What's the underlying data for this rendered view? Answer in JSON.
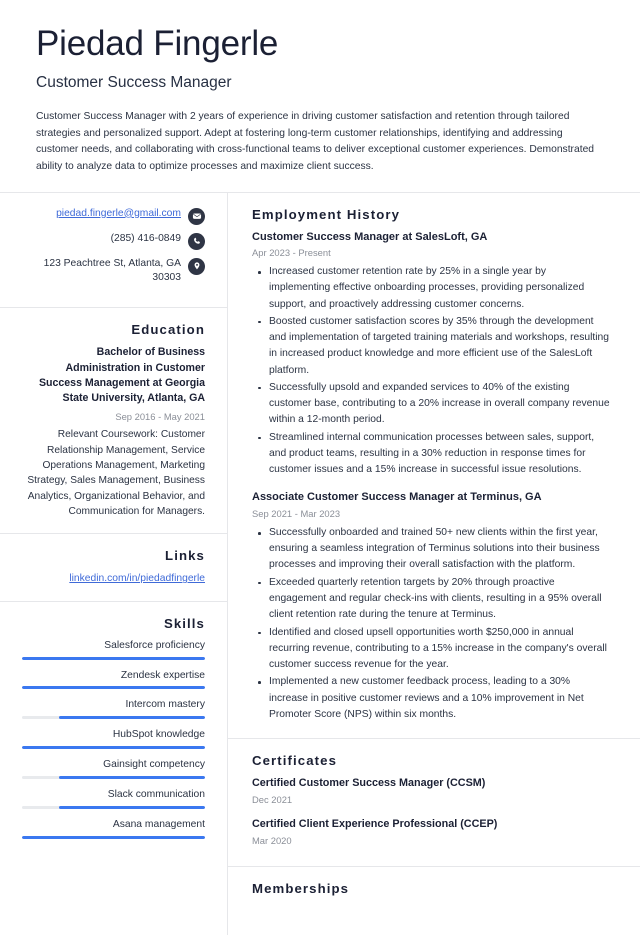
{
  "header": {
    "full_name": "Piedad Fingerle",
    "job_title": "Customer Success Manager",
    "summary": "Customer Success Manager with 2 years of experience in driving customer satisfaction and retention through tailored strategies and personalized support. Adept at fostering long-term customer relationships, identifying and addressing customer needs, and collaborating with cross-functional teams to deliver exceptional customer experiences. Demonstrated ability to analyze data to optimize processes and maximize client success."
  },
  "contact": {
    "email": "piedad.fingerle@gmail.com",
    "phone": "(285) 416-0849",
    "address": "123 Peachtree St, Atlanta, GA 30303",
    "icons": [
      "envelope-icon",
      "phone-icon",
      "location-pin-icon"
    ]
  },
  "education": {
    "title": "Education",
    "entries": [
      {
        "degree": "Bachelor of Business Administration in Customer Success Management at Georgia State University, Atlanta, GA",
        "dates": "Sep 2016 - May 2021",
        "description": "Relevant Coursework: Customer Relationship Management, Service Operations Management, Marketing Strategy, Sales Management, Business Analytics, Organizational Behavior, and Communication for Managers."
      }
    ]
  },
  "links": {
    "title": "Links",
    "items": [
      {
        "label": "linkedin.com/in/piedadfingerle"
      }
    ]
  },
  "skills": {
    "title": "Skills",
    "accent_color": "#3b78f0",
    "track_color": "#e8eaed",
    "items": [
      {
        "name": "Salesforce proficiency",
        "level": 100
      },
      {
        "name": "Zendesk expertise",
        "level": 100
      },
      {
        "name": "Intercom mastery",
        "level": 80
      },
      {
        "name": "HubSpot knowledge",
        "level": 100
      },
      {
        "name": "Gainsight competency",
        "level": 80
      },
      {
        "name": "Slack communication",
        "level": 80
      },
      {
        "name": "Asana management",
        "level": 100
      }
    ]
  },
  "employment": {
    "title": "Employment History",
    "entries": [
      {
        "role": "Customer Success Manager at SalesLoft, GA",
        "dates": "Apr 2023 - Present",
        "bullets": [
          "Increased customer retention rate by 25% in a single year by implementing effective onboarding processes, providing personalized support, and proactively addressing customer concerns.",
          "Boosted customer satisfaction scores by 35% through the development and implementation of targeted training materials and workshops, resulting in increased product knowledge and more efficient use of the SalesLoft platform.",
          "Successfully upsold and expanded services to 40% of the existing customer base, contributing to a 20% increase in overall company revenue within a 12-month period.",
          "Streamlined internal communication processes between sales, support, and product teams, resulting in a 30% reduction in response times for customer issues and a 15% increase in successful issue resolutions."
        ]
      },
      {
        "role": "Associate Customer Success Manager at Terminus, GA",
        "dates": "Sep 2021 - Mar 2023",
        "bullets": [
          "Successfully onboarded and trained 50+ new clients within the first year, ensuring a seamless integration of Terminus solutions into their business processes and improving their overall satisfaction with the platform.",
          "Exceeded quarterly retention targets by 20% through proactive engagement and regular check-ins with clients, resulting in a 95% overall client retention rate during the tenure at Terminus.",
          "Identified and closed upsell opportunities worth $250,000 in annual recurring revenue, contributing to a 15% increase in the company's overall customer success revenue for the year.",
          "Implemented a new customer feedback process, leading to a 30% increase in positive customer reviews and a 10% improvement in Net Promoter Score (NPS) within six months."
        ]
      }
    ]
  },
  "certificates": {
    "title": "Certificates",
    "items": [
      {
        "name": "Certified Customer Success Manager (CCSM)",
        "date": "Dec 2021"
      },
      {
        "name": "Certified Client Experience Professional (CCEP)",
        "date": "Mar 2020"
      }
    ]
  },
  "memberships": {
    "title": "Memberships"
  }
}
